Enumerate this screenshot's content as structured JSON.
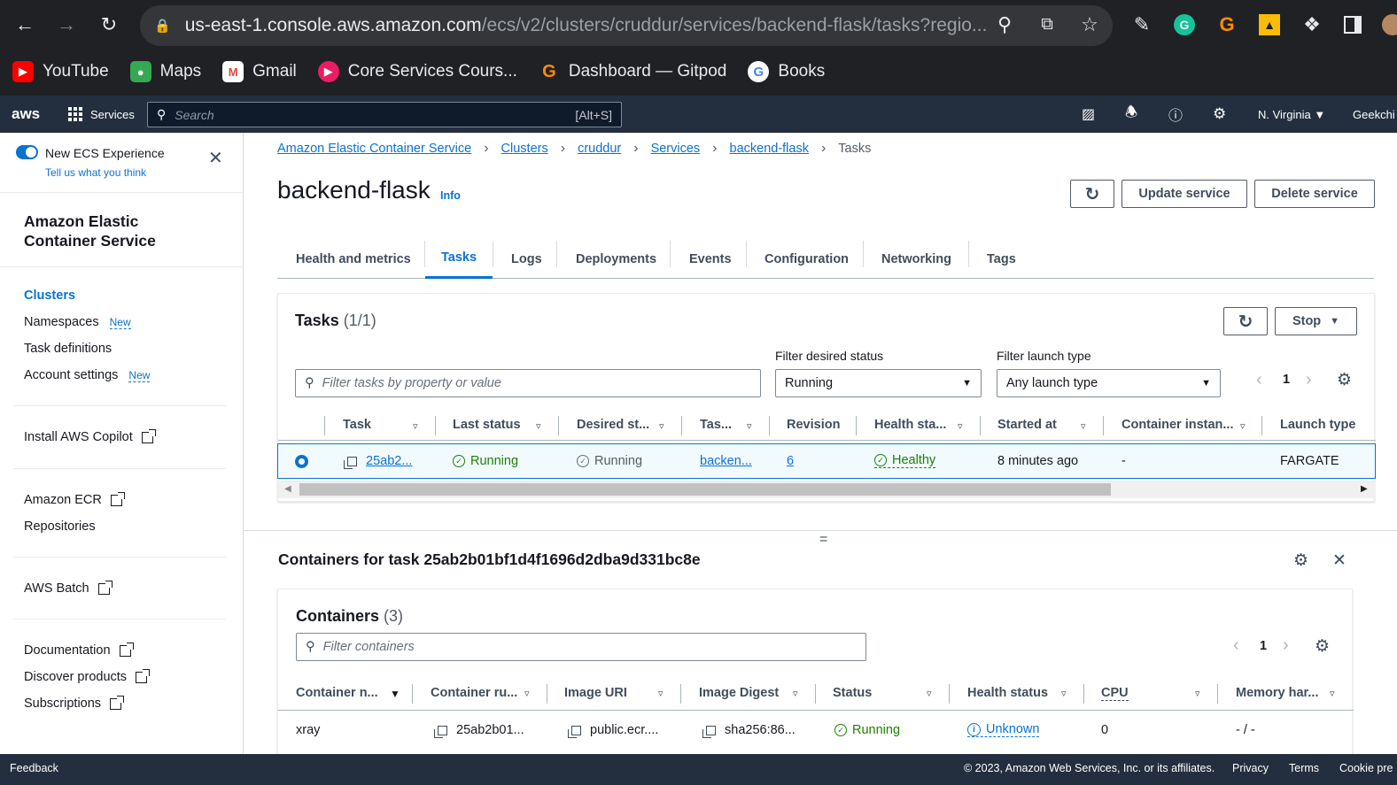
{
  "browser": {
    "url_host": "us-east-1.console.aws.amazon.com",
    "url_path": "/ecs/v2/clusters/cruddur/services/backend-flask/tasks?regio...",
    "bookmarks": [
      {
        "label": "YouTube",
        "color": "#ff0000",
        "icon": "youtube-icon"
      },
      {
        "label": "Maps",
        "color": "#34a853",
        "icon": "maps-icon"
      },
      {
        "label": "Gmail",
        "color": "#ea4335",
        "icon": "gmail-icon"
      },
      {
        "label": "Core Services Cours...",
        "color": "#e91e63",
        "icon": "course-icon"
      },
      {
        "label": "Dashboard — Gitpod",
        "color": "#ff8a00",
        "icon": "gitpod-icon"
      },
      {
        "label": "Books",
        "color": "#4285f4",
        "icon": "google-icon"
      }
    ]
  },
  "topnav": {
    "logo": "aws",
    "services": "Services",
    "search_placeholder": "Search",
    "search_shortcut": "[Alt+S]",
    "region": "N. Virginia ▼",
    "account": "Geekchi"
  },
  "sidebar": {
    "toggle_label": "New ECS Experience",
    "feedback_link": "Tell us what you think",
    "title_line1": "Amazon Elastic",
    "title_line2": "Container Service",
    "clusters": "Clusters",
    "namespaces": "Namespaces",
    "task_definitions": "Task definitions",
    "account_settings": "Account settings",
    "new_badge": "New",
    "install_copilot": "Install AWS Copilot",
    "amazon_ecr": "Amazon ECR",
    "repositories": "Repositories",
    "aws_batch": "AWS Batch",
    "documentation": "Documentation",
    "discover_products": "Discover products",
    "subscriptions": "Subscriptions"
  },
  "breadcrumbs": [
    "Amazon Elastic Container Service",
    "Clusters",
    "cruddur",
    "Services",
    "backend-flask",
    "Tasks"
  ],
  "header": {
    "title": "backend-flask",
    "info": "Info",
    "update_service": "Update service",
    "delete_service": "Delete service"
  },
  "tabs": [
    "Health and metrics",
    "Tasks",
    "Logs",
    "Deployments",
    "Events",
    "Configuration",
    "Networking",
    "Tags"
  ],
  "active_tab": "Tasks",
  "tasks": {
    "title": "Tasks",
    "count": "(1/1)",
    "stop": "Stop",
    "filter_placeholder": "Filter tasks by property or value",
    "desired_status_label": "Filter desired status",
    "desired_status_value": "Running",
    "launch_type_label": "Filter launch type",
    "launch_type_value": "Any launch type",
    "page": "1",
    "columns": [
      "Task",
      "Last status",
      "Desired st...",
      "Tas...",
      "Revision",
      "Health sta...",
      "Started at",
      "Container instan...",
      "Launch type"
    ],
    "row": {
      "task": "25ab2...",
      "last_status": "Running",
      "desired_status": "Running",
      "task_def": "backen...",
      "revision": "6",
      "health": "Healthy",
      "started_at": "8 minutes ago",
      "container_instance": "-",
      "launch_type": "FARGATE"
    }
  },
  "containers_panel": {
    "title": "Containers for task 25ab2b01bf1d4f1696d2dba9d331bc8e",
    "heading": "Containers",
    "count": "(3)",
    "filter_placeholder": "Filter containers",
    "page": "1",
    "columns": [
      "Container n...",
      "Container ru...",
      "Image URI",
      "Image Digest",
      "Status",
      "Health status",
      "CPU",
      "Memory har..."
    ],
    "row": {
      "name": "xray",
      "runtime": "25ab2b01...",
      "image_uri": "public.ecr....",
      "digest": "sha256:86...",
      "status": "Running",
      "health": "Unknown",
      "cpu": "0",
      "memory": "- / -"
    }
  },
  "footer": {
    "feedback": "Feedback",
    "copyright": "© 2023, Amazon Web Services, Inc. or its affiliates.",
    "privacy": "Privacy",
    "terms": "Terms",
    "cookies": "Cookie pre"
  },
  "colors": {
    "link": "#0972d3",
    "success": "#1d8102",
    "nav_bg": "#232f3e",
    "chrome_bg": "#202124"
  }
}
